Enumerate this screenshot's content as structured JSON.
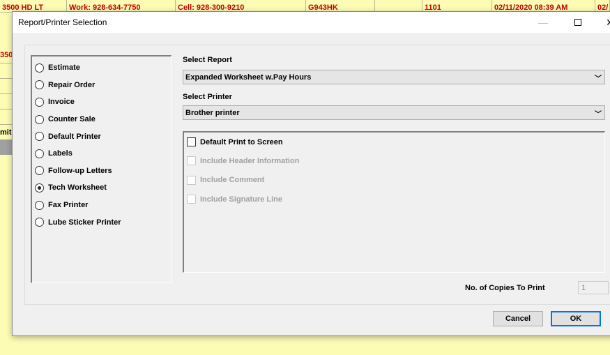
{
  "background": {
    "row": [
      "3500 HD LT",
      "Work: 928-634-7750",
      "Cell: 928-300-9210",
      "G943HK",
      "",
      "1101",
      "02/11/2020 08:39 AM",
      "02/"
    ],
    "left_fragments": [
      "350",
      "mite"
    ]
  },
  "dialog": {
    "title": "Report/Printer Selection",
    "report_types": [
      {
        "label": "Estimate",
        "selected": false
      },
      {
        "label": "Repair Order",
        "selected": false
      },
      {
        "label": "Invoice",
        "selected": false
      },
      {
        "label": "Counter Sale",
        "selected": false
      },
      {
        "label": "Default Printer",
        "selected": false
      },
      {
        "label": "Labels",
        "selected": false
      },
      {
        "label": "Follow-up Letters",
        "selected": false
      },
      {
        "label": "Tech Worksheet",
        "selected": true
      },
      {
        "label": "Fax Printer",
        "selected": false
      },
      {
        "label": "Lube Sticker Printer",
        "selected": false
      }
    ],
    "select_report_label": "Select Report",
    "select_report_value": "Expanded Worksheet w.Pay Hours",
    "select_printer_label": "Select Printer",
    "select_printer_value": "Brother printer",
    "options": [
      {
        "label": "Default Print to Screen",
        "enabled": true,
        "checked": false
      },
      {
        "label": "Include Header Information",
        "enabled": false,
        "checked": false
      },
      {
        "label": "Include Comment",
        "enabled": false,
        "checked": false
      },
      {
        "label": "Include Signature Line",
        "enabled": false,
        "checked": false
      }
    ],
    "copies_label": "No. of Copies To Print",
    "copies_value": "1",
    "cancel": "Cancel",
    "ok": "OK"
  }
}
